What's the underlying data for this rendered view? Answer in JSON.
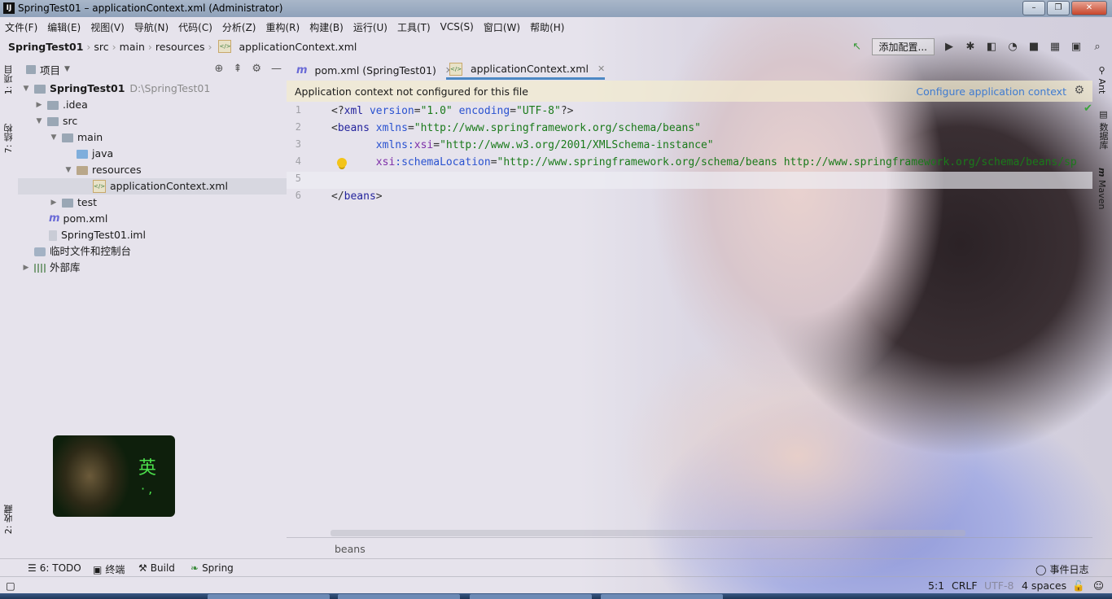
{
  "window": {
    "title": "SpringTest01 – applicationContext.xml (Administrator)",
    "app_icon": "IJ"
  },
  "menu": [
    "文件(F)",
    "编辑(E)",
    "视图(V)",
    "导航(N)",
    "代码(C)",
    "分析(Z)",
    "重构(R)",
    "构建(B)",
    "运行(U)",
    "工具(T)",
    "VCS(S)",
    "窗口(W)",
    "帮助(H)"
  ],
  "breadcrumb": [
    "SpringTest01",
    "src",
    "main",
    "resources",
    "applicationContext.xml"
  ],
  "toolbar": {
    "add_config": "添加配置..."
  },
  "left_stripe": {
    "project": "1: 项目",
    "structure": "7: 结构",
    "favorites": "2: 收藏"
  },
  "project_panel": {
    "title": "项目",
    "tree": [
      {
        "label": "SpringTest01",
        "path": "D:\\SpringTest01",
        "level": 0,
        "icon": "module-folder",
        "expanded": true
      },
      {
        "label": ".idea",
        "level": 1,
        "icon": "folder",
        "expanded": false
      },
      {
        "label": "src",
        "level": 1,
        "icon": "folder",
        "expanded": true
      },
      {
        "label": "main",
        "level": 2,
        "icon": "folder",
        "expanded": true
      },
      {
        "label": "java",
        "level": 3,
        "icon": "source-folder"
      },
      {
        "label": "resources",
        "level": 3,
        "icon": "resources-folder",
        "expanded": true
      },
      {
        "label": "applicationContext.xml",
        "level": 4,
        "icon": "spring-xml-file",
        "selected": true
      },
      {
        "label": "test",
        "level": 2,
        "icon": "folder",
        "expanded": false
      },
      {
        "label": "pom.xml",
        "level": 1,
        "icon": "maven-file"
      },
      {
        "label": "SpringTest01.iml",
        "level": 1,
        "icon": "iml-file"
      },
      {
        "label": "临时文件和控制台",
        "level": 0,
        "icon": "scratches-icon"
      },
      {
        "label": "外部库",
        "level": 0,
        "icon": "libraries-icon",
        "expanded": false
      }
    ]
  },
  "editor": {
    "tabs": [
      {
        "label": "pom.xml (SpringTest01)",
        "active": false
      },
      {
        "label": "applicationContext.xml",
        "active": true
      }
    ],
    "notice": {
      "message": "Application context not configured for this file",
      "link": "Configure application context"
    },
    "line_numbers": [
      "1",
      "2",
      "3",
      "4",
      "5",
      "6"
    ],
    "breadcrumb": "beans"
  },
  "right_stripe": {
    "ant": "Ant",
    "database": "数据库",
    "maven": "Maven"
  },
  "bottom_tools": {
    "todo": "6: TODO",
    "terminal": "终端",
    "build": "Build",
    "spring": "Spring",
    "event_log": "事件日志"
  },
  "status": {
    "position": "5:1",
    "line_sep": "CRLF",
    "encoding": "UTF-8",
    "indent": "4 spaces"
  },
  "ime": {
    "char": "英",
    "symbols": "·,"
  }
}
